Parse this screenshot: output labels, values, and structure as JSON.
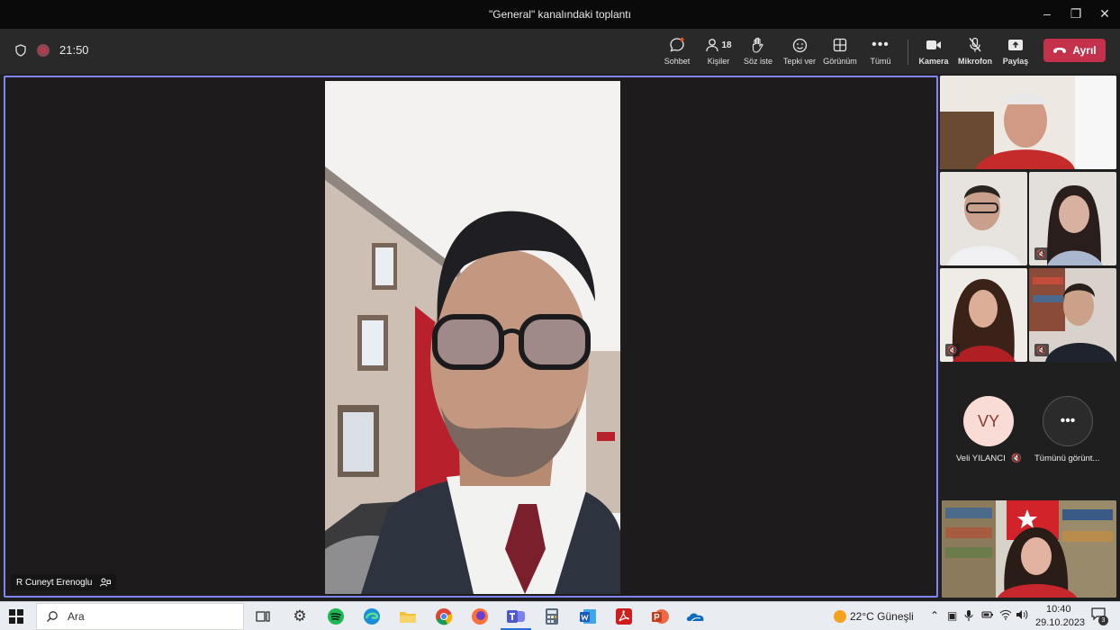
{
  "window": {
    "title": "\"General\" kanalındaki toplantı"
  },
  "toolbar": {
    "timer": "21:50",
    "buttons": [
      {
        "label": "Sohbet",
        "icon": "chat-icon"
      },
      {
        "label": "Kişiler",
        "icon": "people-icon",
        "count": "18"
      },
      {
        "label": "Söz iste",
        "icon": "raise-hand-icon"
      },
      {
        "label": "Tepki ver",
        "icon": "reaction-icon"
      },
      {
        "label": "Görünüm",
        "icon": "layout-icon"
      },
      {
        "label": "Tümü",
        "icon": "more-icon"
      },
      {
        "label": "Kamera",
        "icon": "camera-icon"
      },
      {
        "label": "Mikrofon",
        "icon": "mic-off-icon"
      },
      {
        "label": "Paylaş",
        "icon": "share-icon"
      }
    ],
    "leave_label": "Ayrıl"
  },
  "stage": {
    "speaker_name": "R Cuneyt Erenoglu"
  },
  "side": {
    "avatar_initials": "VY",
    "avatar_name": "Veli YILANCI",
    "view_all_label": "Tümünü görünt..."
  },
  "taskbar": {
    "search_placeholder": "Ara",
    "weather": "22°C  Güneşli",
    "time": "10:40",
    "date": "29.10.2023",
    "notification_count": "3"
  },
  "colors": {
    "accent": "#7f85f5",
    "leave": "#c4314b",
    "avatar_bg": "#f9dcd5",
    "avatar_fg": "#8a3b2a"
  }
}
